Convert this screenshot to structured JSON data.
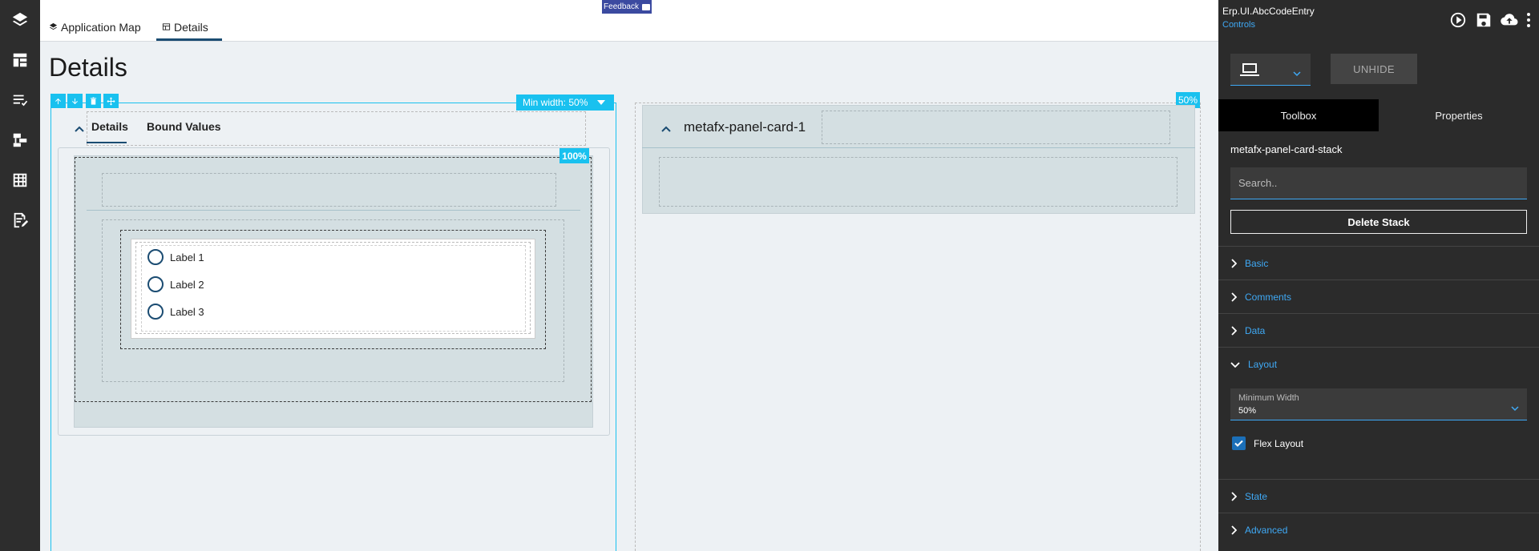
{
  "feedback": {
    "label": "Feedback"
  },
  "topnav": {
    "tabs": [
      {
        "label": "Application Map",
        "icon": "layers-icon"
      },
      {
        "label": "Details",
        "icon": "table-icon"
      }
    ]
  },
  "page": {
    "title": "Details"
  },
  "left_panel": {
    "min_width_label": "Min width: 50%",
    "tabs": [
      {
        "label": "Details"
      },
      {
        "label": "Bound Values"
      }
    ],
    "badge": "100%",
    "radios": [
      {
        "label": "Label 1"
      },
      {
        "label": "Label 2"
      },
      {
        "label": "Label 3"
      }
    ]
  },
  "mid_panel": {
    "badge": "50%",
    "card_title": "metafx-panel-card-1"
  },
  "right_panel": {
    "title": "Erp.UI.AbcCodeEntry",
    "subtitle": "Controls",
    "unhide_label": "UNHIDE",
    "tabs": [
      {
        "label": "Toolbox"
      },
      {
        "label": "Properties"
      }
    ],
    "component_name": "metafx-panel-card-stack",
    "search_placeholder": "Search..",
    "delete_label": "Delete Stack",
    "sections": {
      "basic": "Basic",
      "comments": "Comments",
      "data": "Data",
      "layout": "Layout",
      "state": "State",
      "advanced": "Advanced"
    },
    "min_width_field": {
      "label": "Minimum Width",
      "value": "50%"
    },
    "flex_layout": {
      "label": "Flex Layout",
      "checked": true
    }
  },
  "colors": {
    "accent": "#19c1ef",
    "link": "#3fa9f5",
    "nav_dark": "#2d2d2d",
    "brand_blue": "#1b4c72"
  }
}
